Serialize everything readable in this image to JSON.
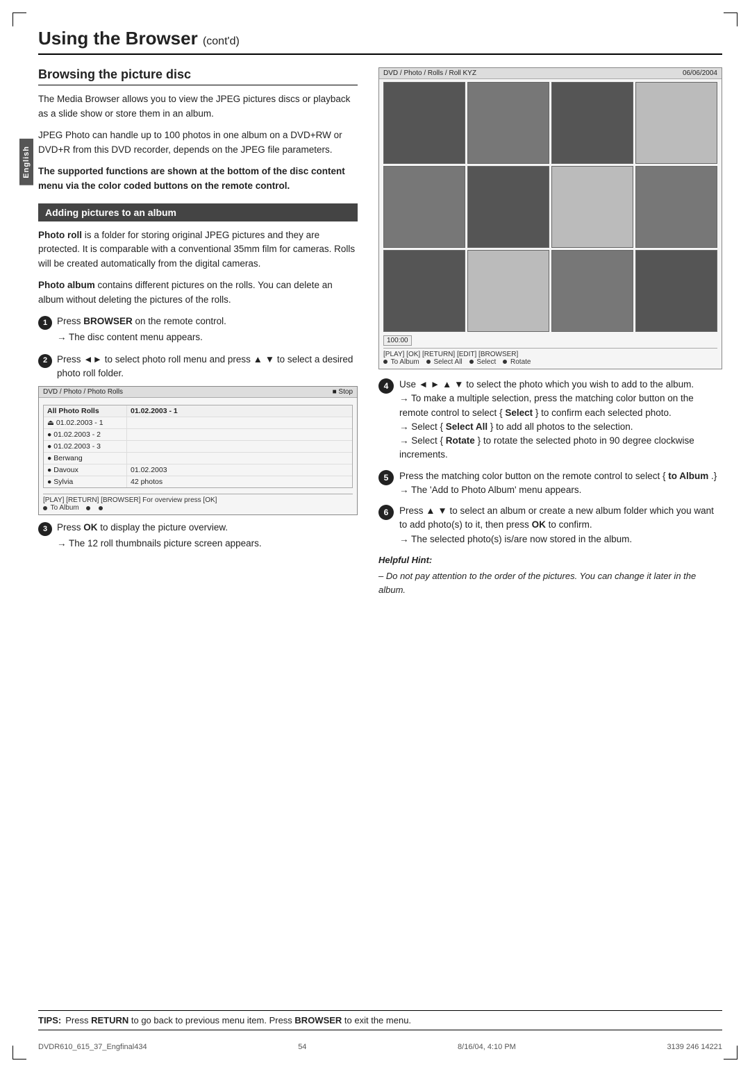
{
  "page": {
    "title": "Using the Browser",
    "title_contd": "cont'd",
    "section": "Browsing the picture disc",
    "english_label": "English",
    "page_number": "54",
    "footer_left": "DVDR610_615_37_Engfinal434",
    "footer_center": "54",
    "footer_right_date": "8/16/04, 4:10 PM",
    "footer_rightmost": "3139 246 14221"
  },
  "left_col": {
    "intro1": "The Media Browser allows you to view the JPEG pictures discs or playback as a slide show or store them in an album.",
    "intro2": "JPEG Photo can handle up to 100 photos in one album on a DVD+RW or DVD+R from this DVD recorder, depends on the JPEG file parameters.",
    "bold_text": "The supported functions are shown at the bottom of the disc content menu via the color coded buttons on the remote control.",
    "sub_heading": "Adding pictures to an album",
    "photo_roll_bold": "Photo roll",
    "photo_roll_text": " is a folder for storing original JPEG pictures and they are protected. It is comparable with a conventional 35mm film for cameras. Rolls will be created automatically from the digital cameras.",
    "photo_album_bold": "Photo album",
    "photo_album_text": " contains different pictures on the rolls. You can delete an album without deleting the pictures of the rolls.",
    "step1_text": "Press ",
    "step1_bold": "BROWSER",
    "step1_text2": " on the remote control.",
    "step1_arrow": "The disc content menu appears.",
    "step2_text": "Press ◄► to select photo roll menu and press ▲ ▼ to select a desired photo roll folder.",
    "step3_text": "Press ",
    "step3_bold": "OK",
    "step3_text2": " to display the picture overview.",
    "step3_arrow": "The 12 roll thumbnails picture screen appears.",
    "screen1": {
      "top_bar_left": "DVD / Photo / Rolls / Roll KYZ",
      "top_bar_right": "06/06/2004",
      "counter": "100:00",
      "buttons": "[PLAY] [OK] [RETURN] [EDIT] [BROWSER]",
      "legend_items": [
        "To Album",
        "Select All",
        "Select",
        "Rotate"
      ]
    },
    "screen2": {
      "top_bar_left": "DVD / Photo / Photo Rolls",
      "top_bar_right": "■ Stop",
      "col1_header": "All Photo Rolls",
      "col2_header": "01.02.2003 - 1",
      "rows": [
        {
          "col1": "⏏ 01.02.2003 - 1",
          "col2": ""
        },
        {
          "col1": "● 01.02.2003 - 2",
          "col2": ""
        },
        {
          "col1": "● 01.02.2003 - 3",
          "col2": ""
        },
        {
          "col1": "● Berwang",
          "col2": ""
        },
        {
          "col1": "● Davoux",
          "col2": "01.02.2003"
        },
        {
          "col1": "● Sylvia",
          "col2": "42 photos"
        }
      ],
      "bottom_buttons": "[PLAY] [RETURN] [BROWSER]  For overview press [OK]",
      "legend": "● To Album  ●  ●"
    }
  },
  "right_col": {
    "step4_text": "Use ◄ ► ▲ ▼ to select the photo which you wish to add to the album.",
    "step4_arrow1": "To make a multiple selection, press the matching color button on the remote control to select { ",
    "step4_select": "Select",
    "step4_arrow1b": " } to confirm each selected photo.",
    "step4_arrow2_pre": "Select { ",
    "step4_select_all": "Select All",
    "step4_arrow2_post": " } to add all photos to the selection.",
    "step4_arrow3_pre": "Select { ",
    "step4_rotate": "Rotate",
    "step4_arrow3_post": " } to rotate the selected photo in 90 degree clockwise increments.",
    "step5_text": "Press the matching color button on the remote control to select { ",
    "step5_bold": "to Album",
    "step5_text2": " .}",
    "step5_arrow": "The 'Add to Photo Album' menu appears.",
    "step6_text": "Press ▲ ▼ to select an album or create a new album folder which you want to add photo(s) to it, then press ",
    "step6_bold": "OK",
    "step6_text2": " to confirm.",
    "step6_arrow1": "The selected photo(s) is/are now stored in the album.",
    "hint_title": "Helpful Hint:",
    "hint_text": "–  Do not pay attention to the order of the pictures. You can change it later in the album."
  },
  "tips": {
    "label": "TIPS:",
    "text": "Press ",
    "return_bold": "RETURN",
    "text2": " to go back to previous menu item. Press ",
    "browser_bold": "BROWSER",
    "text3": " to exit the menu."
  }
}
